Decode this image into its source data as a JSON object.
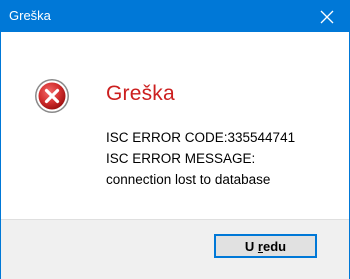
{
  "window": {
    "title": "Greška"
  },
  "dialog": {
    "icon": "error-icon",
    "heading": "Greška",
    "lines": [
      "ISC ERROR CODE:335544741",
      "ISC ERROR MESSAGE:",
      "connection lost to database"
    ]
  },
  "buttons": {
    "ok": {
      "before": "U ",
      "accel": "r",
      "after": "edu"
    }
  },
  "colors": {
    "titlebar": "#0078d7",
    "heading": "#cc1f1f",
    "icon": "#d32f2f",
    "footer": "#f0f0f0"
  }
}
